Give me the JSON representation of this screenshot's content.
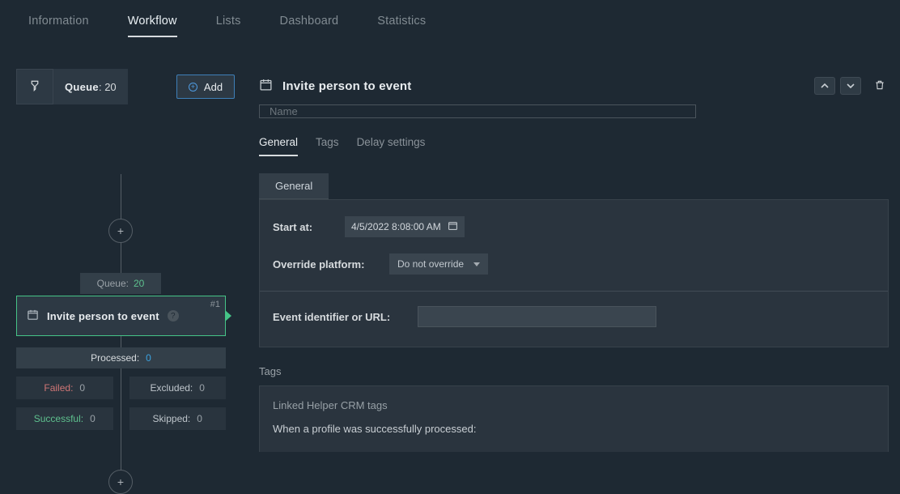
{
  "tabs": [
    "Information",
    "Workflow",
    "Lists",
    "Dashboard",
    "Statistics"
  ],
  "active_tab": "Workflow",
  "workflow": {
    "queue_label": "Queue",
    "queue_count": "20",
    "add_label": "Add",
    "queue_pill": {
      "label": "Queue:",
      "value": "20"
    },
    "step": {
      "title": "Invite person to event",
      "badge": "#1"
    },
    "processed": {
      "label": "Processed:",
      "value": "0"
    },
    "stats": {
      "failed": {
        "label": "Failed:",
        "value": "0"
      },
      "excluded": {
        "label": "Excluded:",
        "value": "0"
      },
      "successful": {
        "label": "Successful:",
        "value": "0"
      },
      "skipped": {
        "label": "Skipped:",
        "value": "0"
      }
    }
  },
  "panel": {
    "title": "Invite person to event",
    "name_placeholder": "Name",
    "subtabs": [
      "General",
      "Tags",
      "Delay settings"
    ],
    "active_subtab": "General",
    "general_section_label": "General",
    "start_at_label": "Start at:",
    "start_at_value": "4/5/2022 8:08:00 AM",
    "override_label": "Override platform:",
    "override_value": "Do not override",
    "event_label": "Event identifier or URL:",
    "tags_header": "Tags",
    "tags_subtitle": "Linked Helper CRM tags",
    "tags_line1": "When a profile was successfully processed:"
  }
}
